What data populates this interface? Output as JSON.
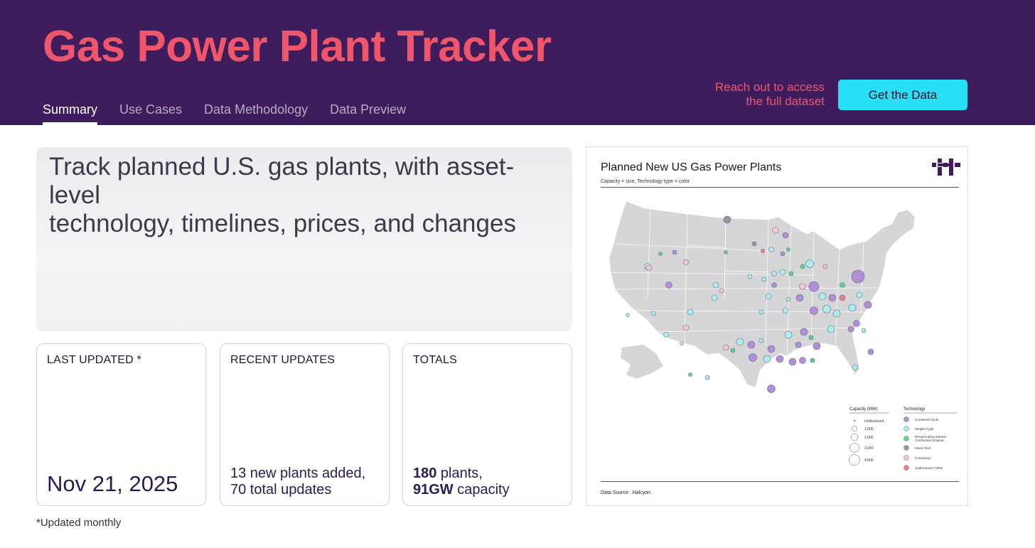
{
  "header": {
    "title": "Gas Power Plant Tracker",
    "tabs": [
      "Summary",
      "Use Cases",
      "Data Methodology",
      "Data Preview"
    ],
    "active_tab": "Summary",
    "cta_text_line1": "Reach out to access",
    "cta_text_line2": "the full dataset",
    "cta_button": "Get the Data"
  },
  "hero": {
    "line1": "Track planned U.S. gas plants, with asset-level",
    "line2": "technology, timelines, prices, and changes"
  },
  "cards": {
    "last_updated": {
      "label": "LAST UPDATED *",
      "value": "Nov 21, 2025"
    },
    "recent_updates": {
      "label": "RECENT UPDATES",
      "line1": "13 new plants added,",
      "line2": "70 total updates"
    },
    "totals": {
      "label": "TOTALS",
      "plants_num": "180",
      "plants_suffix": " plants,",
      "capacity_num": "91GW",
      "capacity_suffix": " capacity"
    }
  },
  "footnote": "*Updated monthly",
  "map": {
    "title": "Planned New US Gas Power Plants",
    "subtitle": "Capacity = size, Technology type = color",
    "source": "Data Source : Halcyon",
    "legend_capacity_title": "Capacity (MW)",
    "legend_capacity": [
      "Undisclosed",
      "1,000",
      "2,000",
      "3,000",
      "4,000"
    ],
    "legend_tech_title": "Technology",
    "legend_tech": [
      "Combined-Cycle",
      "Simple-Cycle",
      "Reciprocating Internal",
      "Combustion Engines",
      "Mixed Tech",
      "Conversion",
      "Undisclosed / Other"
    ]
  },
  "colors": {
    "header_bg": "#3f1d5c",
    "title": "#f0566b",
    "cta_button": "#27e0f5",
    "combined_cycle": "#b08fd8",
    "simple_cycle": "#a8eef2",
    "recip_engines": "#5fd38f",
    "mixed_tech": "#9a93a8",
    "conversion": "#f4c6d4",
    "undisclosed": "#ef7a8a"
  }
}
